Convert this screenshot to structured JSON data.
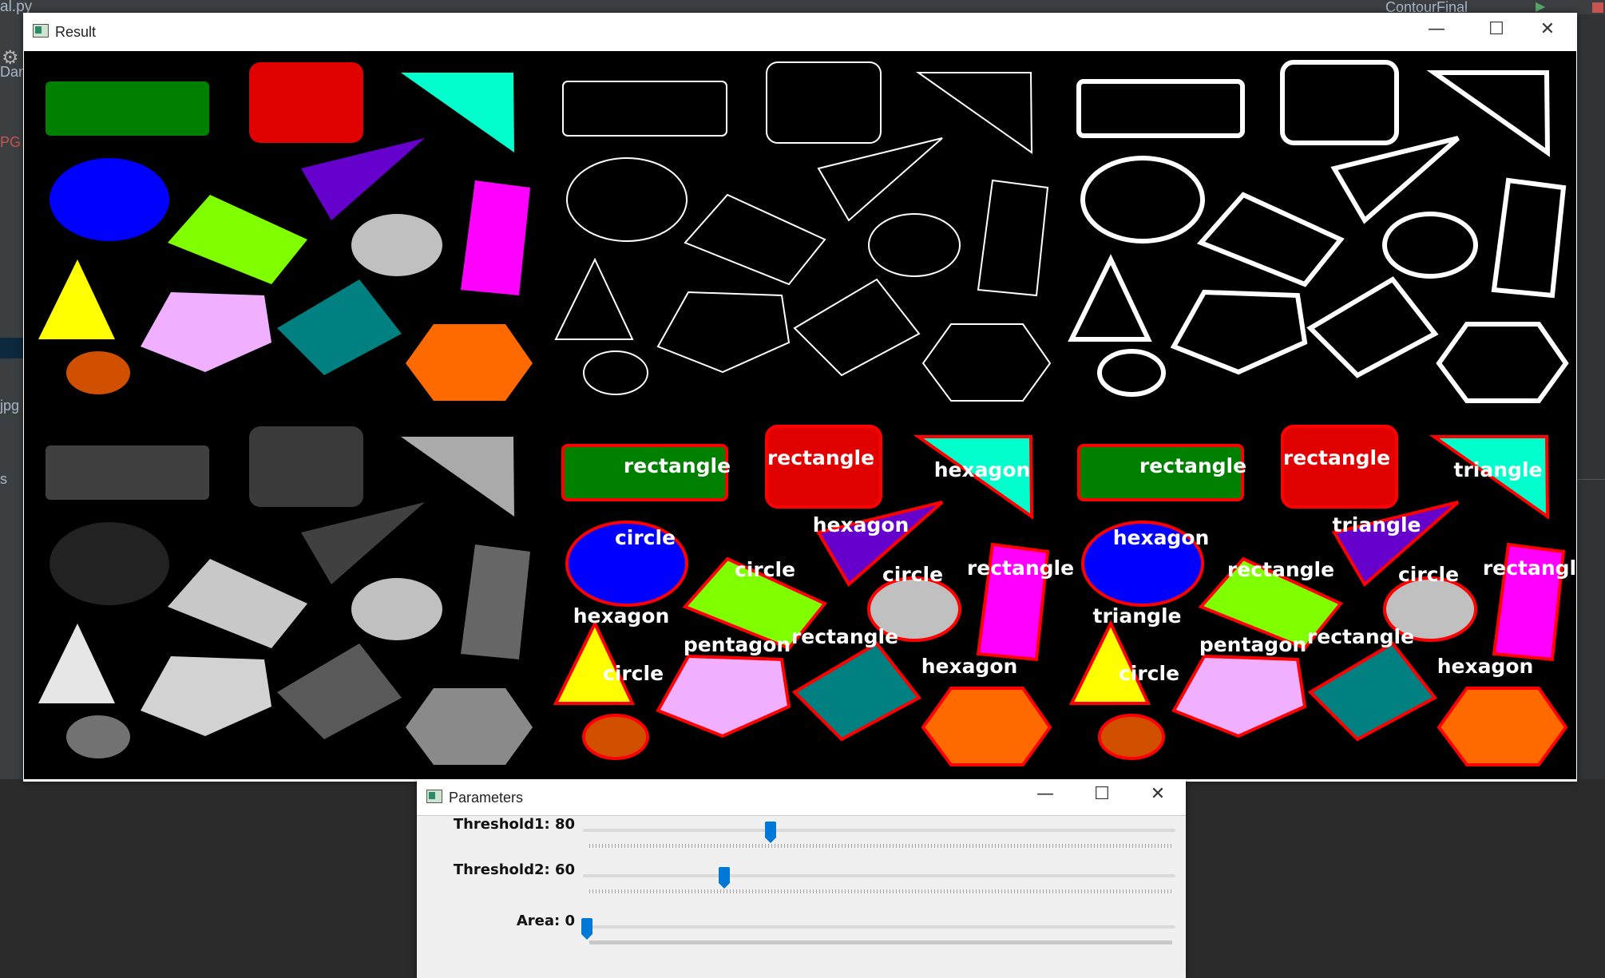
{
  "ide": {
    "file_tab": "al.py",
    "run_config": "ContourFinal",
    "side_texts": [
      "Dan",
      "PG",
      "jpg",
      "s"
    ]
  },
  "result_window": {
    "title": "Result",
    "minimize_glyph": "—",
    "maximize_glyph": "☐",
    "close_glyph": "✕",
    "labels_stack3": [
      "rectangle",
      "rectangle",
      "hexagon",
      "circle",
      "hexagon",
      "circle",
      "circle",
      "rectangle",
      "hexagon",
      "pentagon",
      "rectangle",
      "circle",
      "hexagon"
    ],
    "labels_stack4": [
      "rectangle",
      "rectangle",
      "triangle",
      "hexagon",
      "triangle",
      "rectangle",
      "circle",
      "rectangle",
      "triangle",
      "pentagon",
      "rectangle",
      "circle",
      "hexagon"
    ]
  },
  "params_window": {
    "title": "Parameters",
    "minimize_glyph": "—",
    "maximize_glyph": "☐",
    "close_glyph": "✕",
    "sliders": [
      {
        "label": "Threshold1: 80",
        "value": 80,
        "max": 255
      },
      {
        "label": "Threshold2: 60",
        "value": 60,
        "max": 255
      },
      {
        "label": "Area: 0",
        "value": 0,
        "max": 30000
      }
    ]
  }
}
